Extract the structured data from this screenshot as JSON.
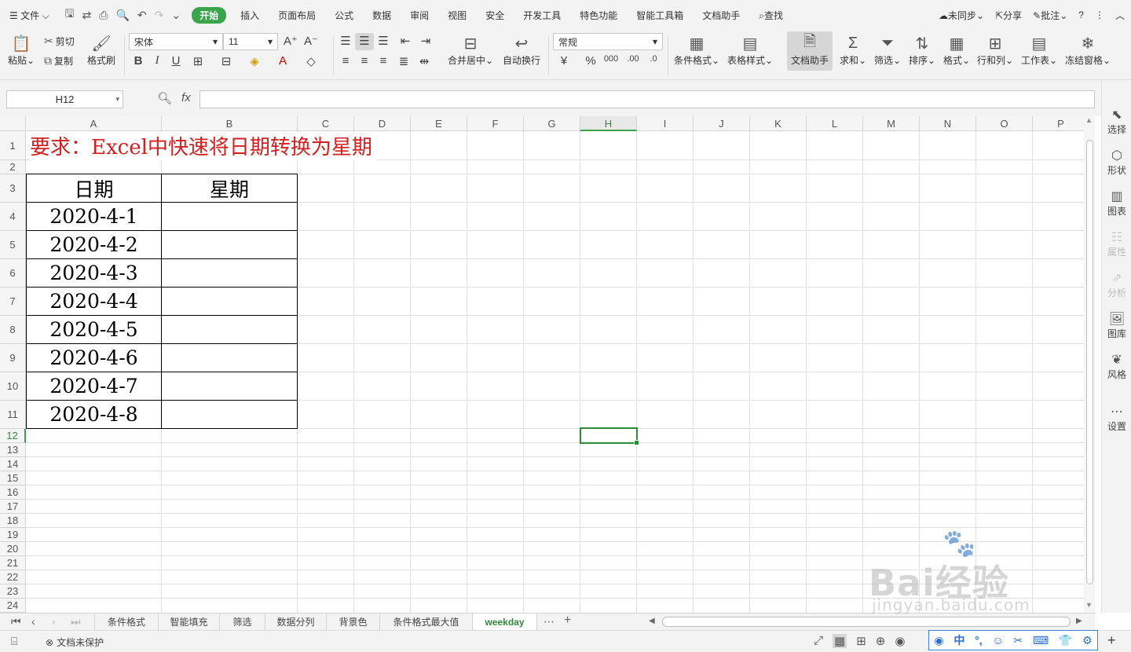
{
  "menubar": {
    "file": "文件",
    "tabs": [
      "开始",
      "插入",
      "页面布局",
      "公式",
      "数据",
      "审阅",
      "视图",
      "安全",
      "开发工具",
      "特色功能",
      "智能工具箱",
      "文档助手"
    ],
    "search": "查找",
    "sync": "未同步",
    "share": "分享",
    "comment": "批注"
  },
  "ribbon": {
    "paste": "粘贴",
    "cut": "剪切",
    "copy": "复制",
    "format_painter": "格式刷",
    "font_name": "宋体",
    "font_size": "11",
    "merge_center": "合并居中",
    "wrap_text": "自动换行",
    "number_format": "常规",
    "conditional_format": "条件格式",
    "table_style": "表格样式",
    "doc_helper": "文档助手",
    "sum": "求和",
    "filter": "筛选",
    "sort": "排序",
    "format": "格式",
    "row_col": "行和列",
    "worksheet": "工作表",
    "freeze": "冻结窗格"
  },
  "formula_bar": {
    "name_box": "H12",
    "fx": "fx",
    "value": ""
  },
  "columns": [
    "A",
    "B",
    "C",
    "D",
    "E",
    "F",
    "G",
    "H",
    "I",
    "J",
    "K",
    "L",
    "M",
    "N",
    "O",
    "P"
  ],
  "active_column": "H",
  "rows": [
    "1",
    "2",
    "3",
    "4",
    "5",
    "6",
    "7",
    "8",
    "9",
    "10",
    "11",
    "12",
    "13",
    "14",
    "15",
    "16",
    "17",
    "18",
    "19",
    "20",
    "21",
    "22",
    "23",
    "24"
  ],
  "active_row": "12",
  "sheet": {
    "title": "要求：Excel中快速将日期转换为星期",
    "header_date": "日期",
    "header_weekday": "星期",
    "dates": [
      "2020-4-1",
      "2020-4-2",
      "2020-4-3",
      "2020-4-4",
      "2020-4-5",
      "2020-4-6",
      "2020-4-7",
      "2020-4-8"
    ],
    "weekdays": [
      "",
      "",
      "",
      "",
      "",
      "",
      "",
      ""
    ]
  },
  "side_panel": [
    {
      "label": "选择",
      "icon": "cursor-icon",
      "enabled": true
    },
    {
      "label": "形状",
      "icon": "shape-icon",
      "enabled": true
    },
    {
      "label": "图表",
      "icon": "chart-icon",
      "enabled": true
    },
    {
      "label": "属性",
      "icon": "properties-icon",
      "enabled": false
    },
    {
      "label": "分析",
      "icon": "analysis-icon",
      "enabled": false
    },
    {
      "label": "图库",
      "icon": "gallery-icon",
      "enabled": true
    },
    {
      "label": "风格",
      "icon": "style-icon",
      "enabled": true
    },
    {
      "label": "设置",
      "icon": "settings-icon",
      "enabled": true
    }
  ],
  "sheet_tabs": [
    "条件格式",
    "智能填充",
    "筛选",
    "数据分列",
    "背景色",
    "条件格式最大值",
    "weekday"
  ],
  "active_sheet_tab": "weekday",
  "status": {
    "protect": "文档未保护"
  },
  "ime": {
    "lang": "中"
  },
  "watermark": {
    "brand": "Bai经验",
    "url": "jingyan.baidu.com"
  },
  "colors": {
    "accent": "#38a54a",
    "title_red": "#d42020",
    "selection_green": "#2e8b3a"
  }
}
